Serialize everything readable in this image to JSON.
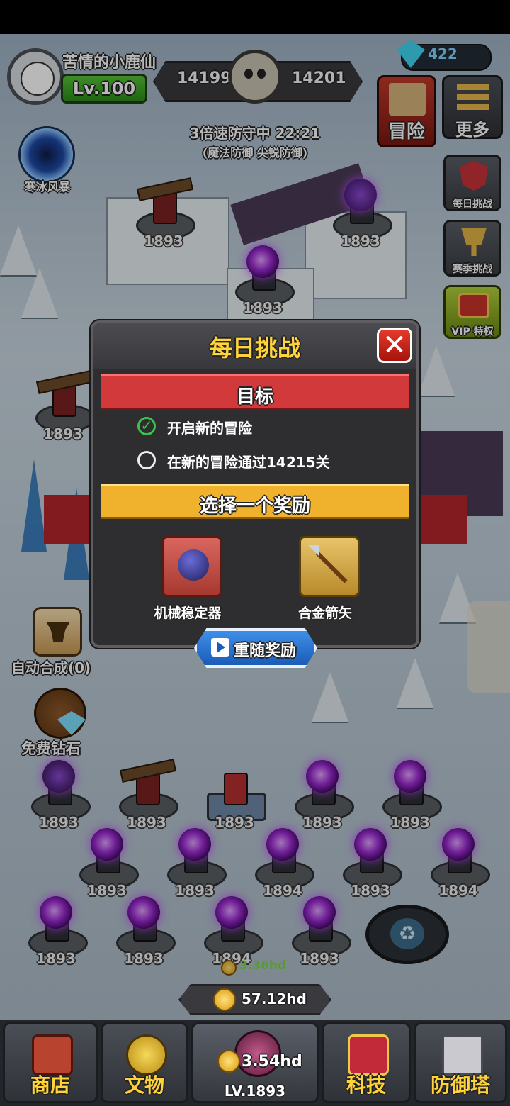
{
  "player": {
    "name": "苦情的小鹿仙",
    "level_label": "Lv.100"
  },
  "scores": {
    "left": "14199",
    "right": "14201"
  },
  "gems": {
    "count": "422"
  },
  "top_right": {
    "adventure": "冒险",
    "more": "更多"
  },
  "side_menu": {
    "daily": "每日挑战",
    "season": "赛季挑战",
    "vip": "VIP 特权"
  },
  "skill": {
    "label": "寒冰风暴"
  },
  "defense": {
    "status": "3倍速防守中 22:21",
    "tags": "(魔法防御 尖锐防御)"
  },
  "left_actions": {
    "auto_merge": "自动合成(0)",
    "free_gems": "免费钻石"
  },
  "dialog": {
    "title": "每日挑战",
    "close": "✕",
    "goal_header": "目标",
    "goals": [
      {
        "text": "开启新的冒险",
        "done": true
      },
      {
        "text": "在新的冒险通过14215关",
        "done": false
      }
    ],
    "reward_header": "选择一个奖励",
    "rewards": [
      {
        "name": "机械稳定器",
        "icon": "mechanical-stabilizer-icon"
      },
      {
        "name": "合金箭矢",
        "icon": "alloy-arrow-icon"
      }
    ],
    "reroll": "重随奖励"
  },
  "towers": {
    "map": [
      "1893",
      "1893",
      "1893",
      "1893"
    ],
    "field_row1": [
      "1893",
      "1893",
      "1893",
      "1893",
      "1893"
    ],
    "field_row2": [
      "1893",
      "1893",
      "1894",
      "1893",
      "1894"
    ],
    "field_row3": [
      "1893",
      "1893",
      "1894",
      "1893"
    ]
  },
  "floating_gain": "3.36hd",
  "gold": {
    "total": "57.12hd",
    "per_tower": "3.54hd",
    "tower_level": "LV.1893"
  },
  "nav": {
    "shop": "商店",
    "artifacts": "文物",
    "tech": "科技",
    "defense_tower": "防御塔"
  },
  "colors": {
    "title_gold": "#ffd43a",
    "goal_red": "#d2393a",
    "reward_gold": "#f0b22c",
    "check_green": "#3bc24a",
    "reroll_blue": "#1a5cb8"
  }
}
